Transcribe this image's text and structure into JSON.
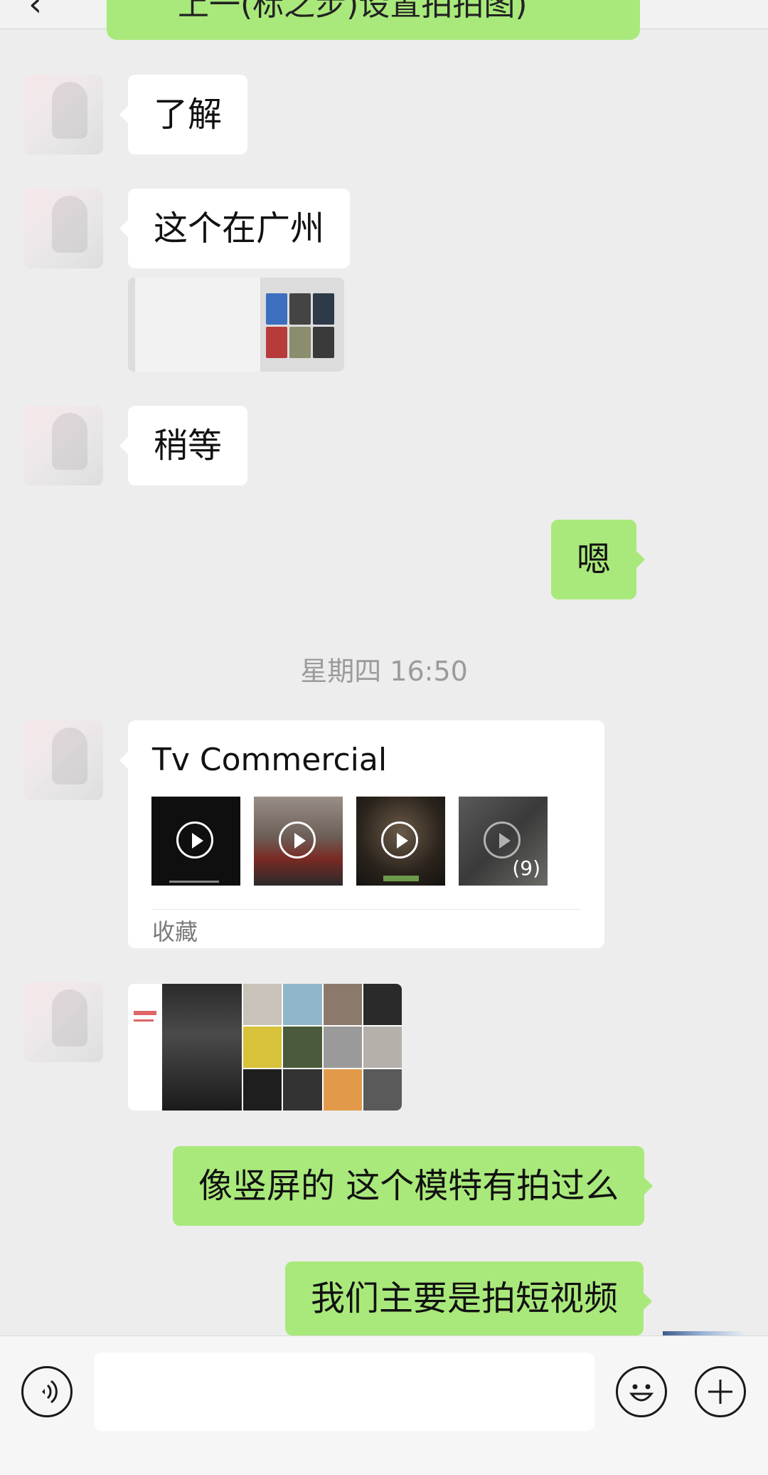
{
  "top": {
    "back_glyph": "‹",
    "cut_text": "上一(标之步)设置拍拍图)"
  },
  "messages": {
    "m1": "了解",
    "m2": "这个在广州",
    "m3": "稍等",
    "m4": "嗯",
    "timestamp": "星期四 16:50",
    "card_title": "Tv Commercial",
    "card_footer": "收藏",
    "card_count": "(9)",
    "m5": "像竖屏的 这个模特有拍过么",
    "m6": "我们主要是拍短视频"
  },
  "colors": {
    "background": "#ededed",
    "sent_bubble": "#a9e97b",
    "received_bubble": "#ffffff",
    "timestamp_text": "#9b9b9b"
  },
  "icons": {
    "voice": "voice-icon",
    "emoji": "emoji-icon",
    "plus": "plus-icon"
  }
}
